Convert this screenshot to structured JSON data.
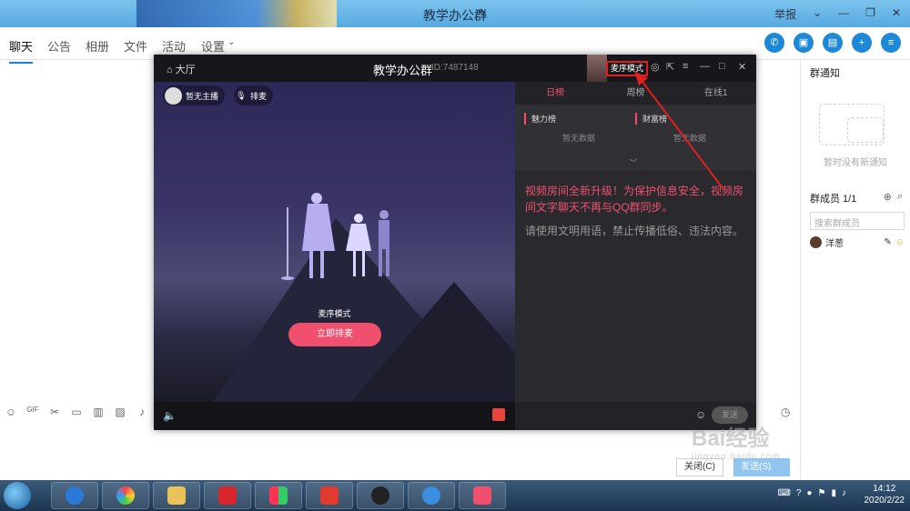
{
  "window": {
    "title": "教学办公群",
    "report_label": "举报"
  },
  "tabs": [
    "聊天",
    "公告",
    "相册",
    "文件",
    "活动",
    "设置"
  ],
  "right_panel": {
    "notice_title": "群通知",
    "notice_empty": "暂时没有新通知",
    "members_title": "群成员 1/1",
    "member_search_placeholder": "搜索群成员",
    "members": [
      {
        "name": "洋葱"
      }
    ]
  },
  "room": {
    "lobby": "大厅",
    "title": "教学办公群",
    "id": "ID:7487148",
    "mode_label": "麦序模式",
    "host_label": "暂无主播",
    "queue_label": "排麦",
    "stage_mode_label": "麦序模式",
    "queue_button": "立即排麦",
    "tabs": [
      "日榜",
      "周榜",
      "在线1"
    ],
    "rank_charm": "魅力榜",
    "rank_wealth": "财富榜",
    "rank_empty": "暂无数据",
    "system_msg_1": "视频房间全新升级！为保护信息安全，视频房间文字聊天不再与QQ群同步。",
    "system_msg_2": "请使用文明用语，禁止传播低俗、违法内容。",
    "send_label": "发送"
  },
  "chat": {
    "close_label": "关闭(C)",
    "send_label": "发送(S)"
  },
  "taskbar": {
    "time": "14:12",
    "date": "2020/2/22"
  },
  "watermark": {
    "main": "Bai经验",
    "sub": "jingyan.baidu.com"
  },
  "colors": {
    "accent": "#f0506e",
    "highlight": "#e02020",
    "qq_blue": "#1e88d6"
  }
}
